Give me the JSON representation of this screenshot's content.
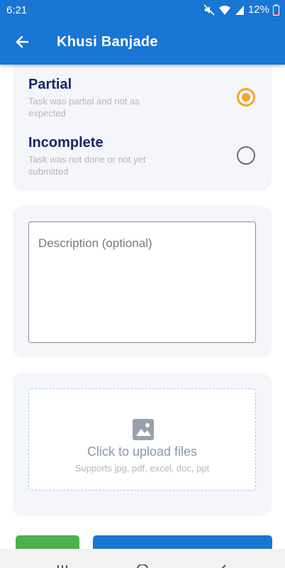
{
  "status_bar": {
    "time": "6:21",
    "battery": "12%",
    "icons": [
      "mute-icon",
      "wifi-icon",
      "signal-icon",
      "battery-icon"
    ]
  },
  "app_bar": {
    "title": "Khusi Banjade",
    "back_icon": "arrow-left-icon"
  },
  "status_options": [
    {
      "title": "Partial",
      "subtitle": "Task was partial and not as\n expected",
      "selected": true
    },
    {
      "title": "Incomplete",
      "subtitle": "Task was not done or not yet\n submitted",
      "selected": false
    }
  ],
  "description": {
    "placeholder": "Description (optional)",
    "value": ""
  },
  "upload": {
    "icon": "image-icon",
    "title": "Click to upload files",
    "subtitle": "Supports jpg, pdf, excel, doc, ppt"
  },
  "actions": {
    "cancel_label": "",
    "primary_label": ""
  },
  "colors": {
    "primary": "#1976d2",
    "accent": "#f5a623",
    "cancel": "#4caf50",
    "option_title": "#14256b",
    "card_bg": "#f5f6f9"
  }
}
